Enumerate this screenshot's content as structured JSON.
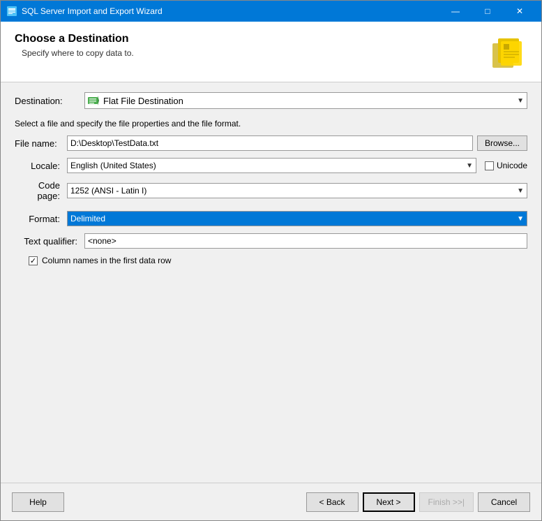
{
  "window": {
    "title": "SQL Server Import and Export Wizard"
  },
  "header": {
    "title": "Choose a Destination",
    "subtitle": "Specify where to copy data to."
  },
  "form": {
    "destination_label": "Destination:",
    "destination_value": "Flat File Destination",
    "file_info": "Select a file and specify the file properties and the file format.",
    "file_name_label": "File name:",
    "file_name_value": "D:\\Desktop\\TestData.txt",
    "browse_label": "Browse...",
    "locale_label": "Locale:",
    "locale_value": "English (United States)",
    "unicode_label": "Unicode",
    "codepage_label": "Code page:",
    "codepage_value": "1252  (ANSI - Latin I)",
    "format_label": "Format:",
    "format_value": "Delimited",
    "text_qual_label": "Text qualifier:",
    "text_qual_value": "<none>",
    "col_names_label": "Column names in the first data row"
  },
  "footer": {
    "help_label": "Help",
    "back_label": "< Back",
    "next_label": "Next >",
    "finish_label": "Finish >>|",
    "cancel_label": "Cancel"
  }
}
